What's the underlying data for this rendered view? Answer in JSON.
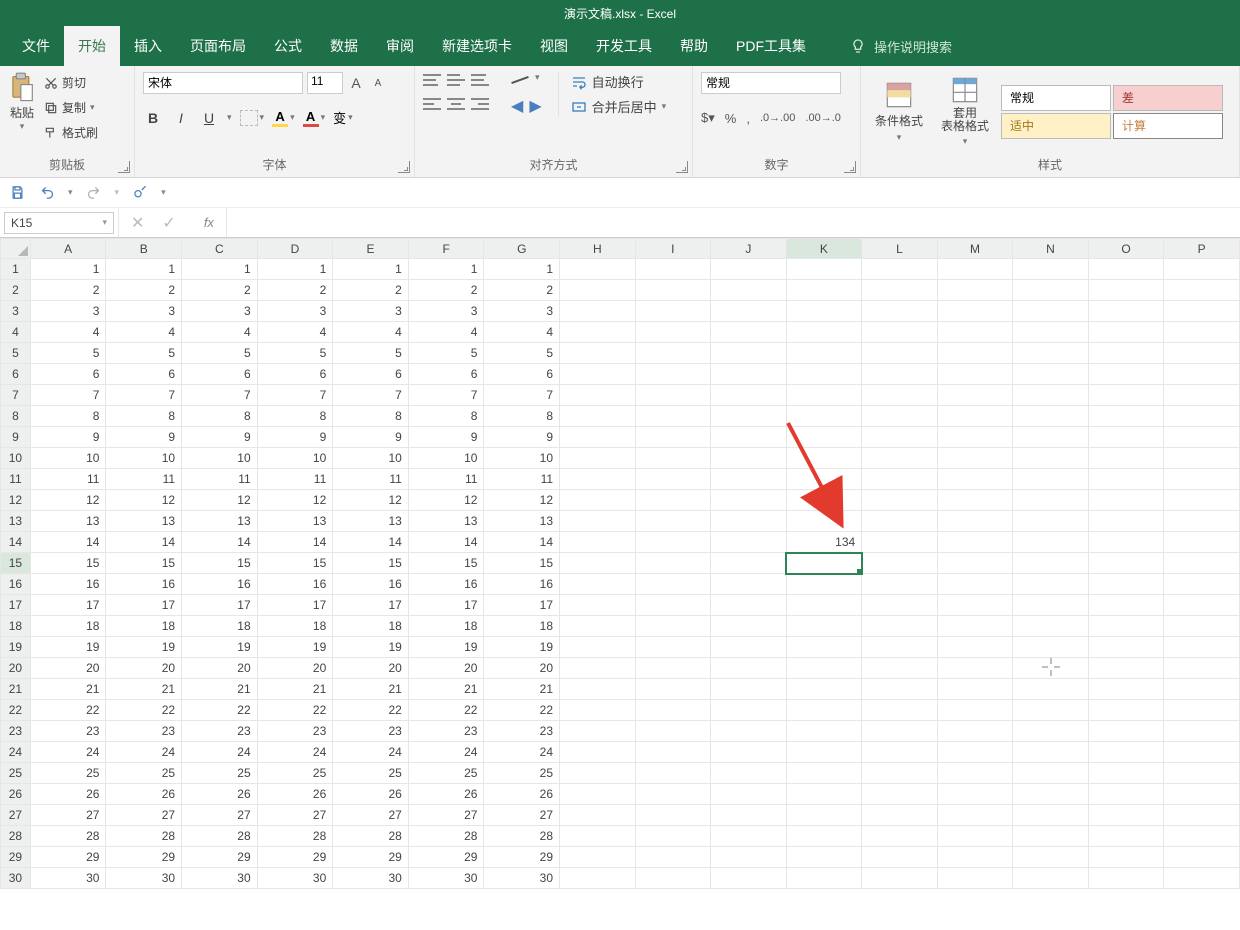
{
  "title": "演示文稿.xlsx  -  Excel",
  "menu": [
    "文件",
    "开始",
    "插入",
    "页面布局",
    "公式",
    "数据",
    "审阅",
    "新建选项卡",
    "视图",
    "开发工具",
    "帮助",
    "PDF工具集"
  ],
  "menu_active_index": 1,
  "search_placeholder": "操作说明搜索",
  "ribbon": {
    "clipboard": {
      "paste": "粘贴",
      "cut": "剪切",
      "copy": "复制",
      "format_painter": "格式刷",
      "label": "剪贴板"
    },
    "font": {
      "name": "宋体",
      "size": "11",
      "bold": "B",
      "italic": "I",
      "underline": "U",
      "fill_letter": "A",
      "color_letter": "A",
      "pinyin_letter": "变",
      "label": "字体",
      "increase": "A",
      "decrease": "A"
    },
    "align": {
      "wrap": "自动换行",
      "merge": "合并后居中",
      "label": "对齐方式"
    },
    "number": {
      "format": "常规",
      "percent": "%",
      "comma": ",",
      "label": "数字",
      "currency": "$"
    },
    "styles": {
      "cond": "条件格式",
      "table": "套用\n表格格式",
      "normal": "常规",
      "bad": "差",
      "neutral": "适中",
      "calc": "计算",
      "label": "样式"
    }
  },
  "formula_bar": {
    "name_box": "K15",
    "fx": "fx"
  },
  "columns": [
    "A",
    "B",
    "C",
    "D",
    "E",
    "F",
    "G",
    "H",
    "I",
    "J",
    "K",
    "L",
    "M",
    "N",
    "O",
    "P"
  ],
  "rows": 30,
  "data_fill_cols": [
    "A",
    "B",
    "C",
    "D",
    "E",
    "F",
    "G"
  ],
  "extra_cell": {
    "col": "K",
    "row": 14,
    "value": "134"
  },
  "selected": {
    "col": "K",
    "row": 15
  }
}
